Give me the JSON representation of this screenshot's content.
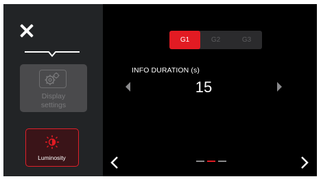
{
  "sidebar": {
    "close_icon": "close-icon",
    "divider_icon": "chevron-divider-icon",
    "display_settings": {
      "label": "Display\nsettings",
      "icon": "gear-settings-icon",
      "enabled": false
    },
    "luminosity": {
      "label": "Luminosity",
      "icon": "luminosity-icon",
      "active": true
    }
  },
  "main": {
    "tabs": [
      {
        "label": "G1",
        "active": true
      },
      {
        "label": "G2",
        "active": false
      },
      {
        "label": "G3",
        "active": false
      }
    ],
    "setting_label": "INFO DURATION (s)",
    "setting_value": "15",
    "pager": {
      "pages": 3,
      "current": 2
    }
  },
  "colors": {
    "accent": "#e21b23",
    "background": "#000000",
    "sidebar": "#222426",
    "disabled_button": "#4a4a4c"
  }
}
